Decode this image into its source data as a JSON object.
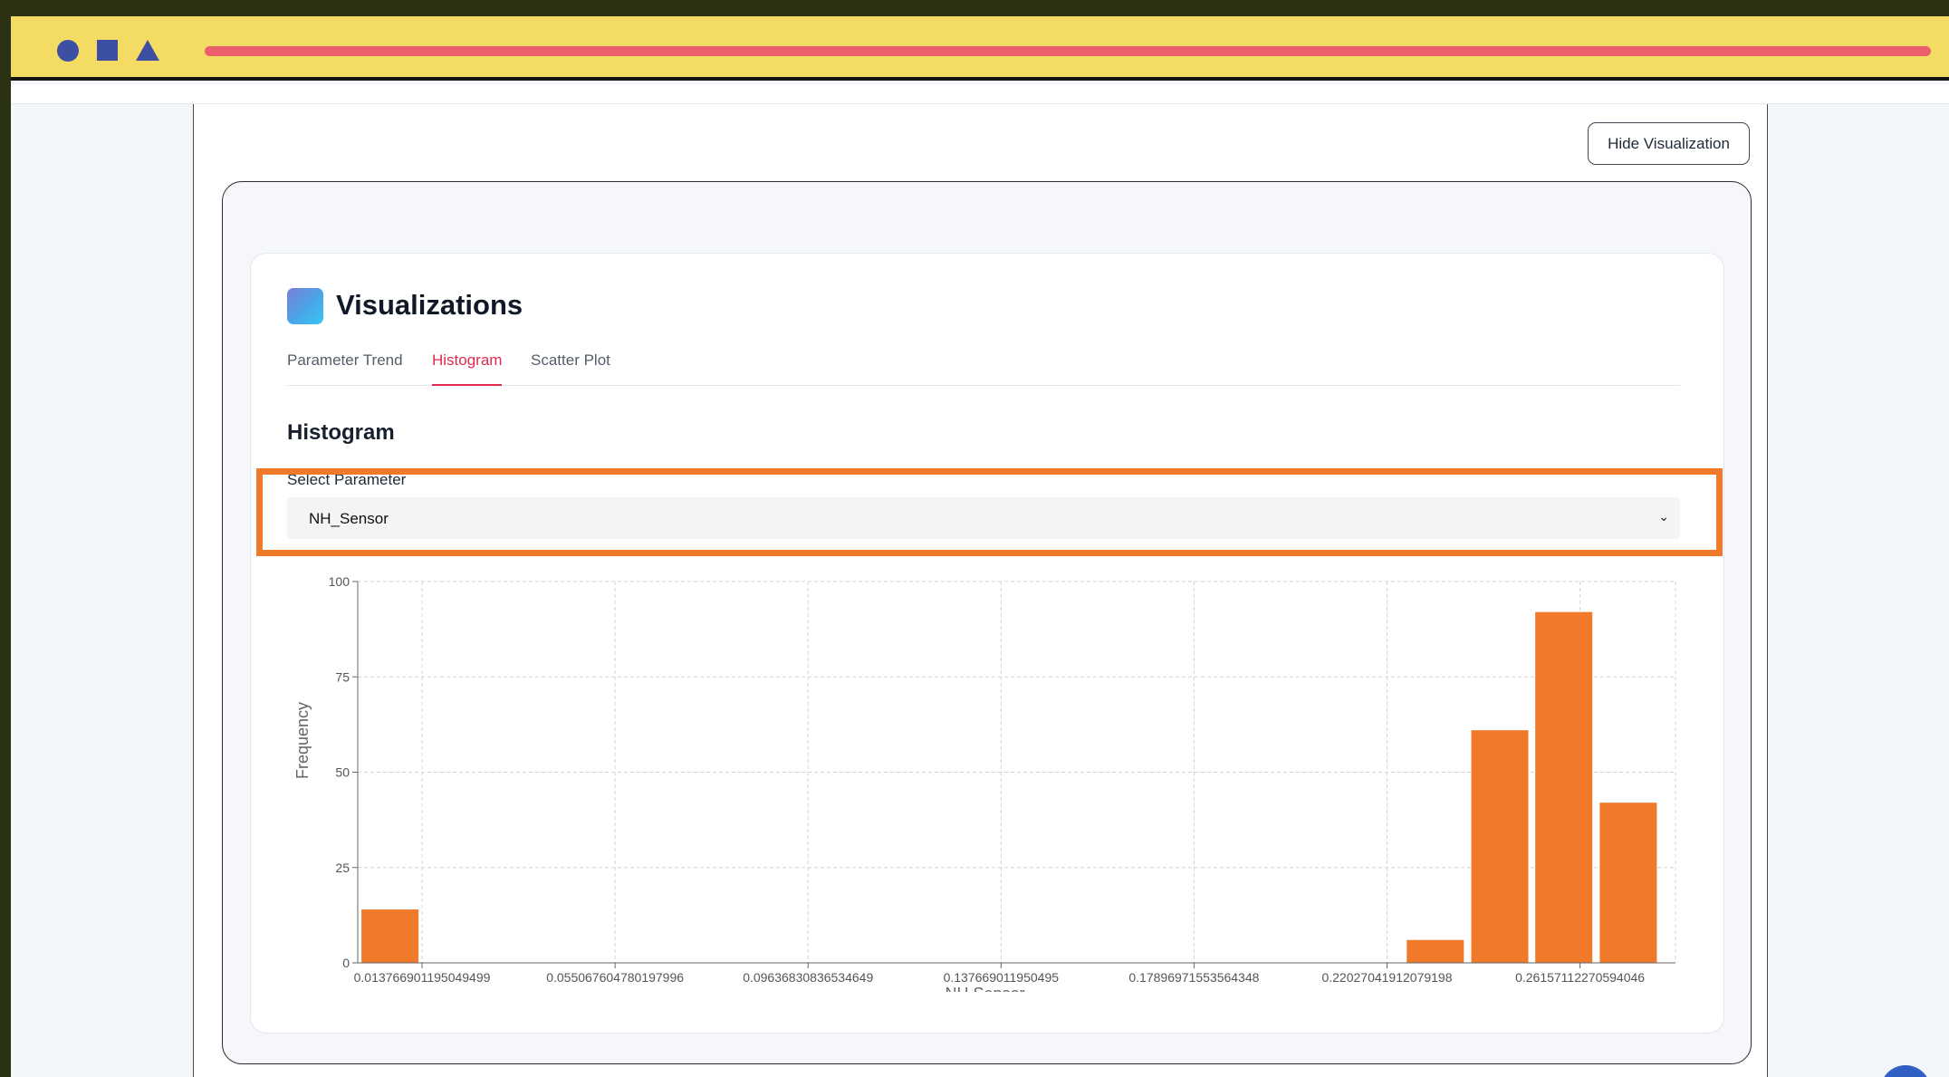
{
  "page": {
    "hide_button": "Hide Visualization"
  },
  "card": {
    "title": "Visualizations",
    "tabs": [
      "Parameter Trend",
      "Histogram",
      "Scatter Plot"
    ],
    "active_tab": "Histogram",
    "section_title": "Histogram",
    "select_label": "Select Parameter",
    "select_value": "NH_Sensor"
  },
  "colors": {
    "chrome": "#f4dc64",
    "accent": "#e0294f",
    "bar": "#f07a2a",
    "highlight": "#f07a2a",
    "shapes": "#3d4fa3"
  },
  "chart_data": {
    "type": "bar",
    "xlabel": "NH  Sensor",
    "ylabel": "Frequency",
    "ylim": [
      0,
      100
    ],
    "yticks": [
      0,
      25,
      50,
      75,
      100
    ],
    "xlim": [
      0.0,
      0.282
    ],
    "xticks": [
      "0.013766901195049499",
      "0.055067604780197996",
      "0.09636830836534649",
      "0.137669011950495",
      "0.17896971553564348",
      "0.22027041912079198",
      "0.26157112270594046"
    ],
    "grid": true,
    "bins": [
      {
        "x": 0.0069,
        "value": 14
      },
      {
        "x": 0.2306,
        "value": 6
      },
      {
        "x": 0.2444,
        "value": 61
      },
      {
        "x": 0.2581,
        "value": 92
      },
      {
        "x": 0.2719,
        "value": 42
      }
    ]
  }
}
